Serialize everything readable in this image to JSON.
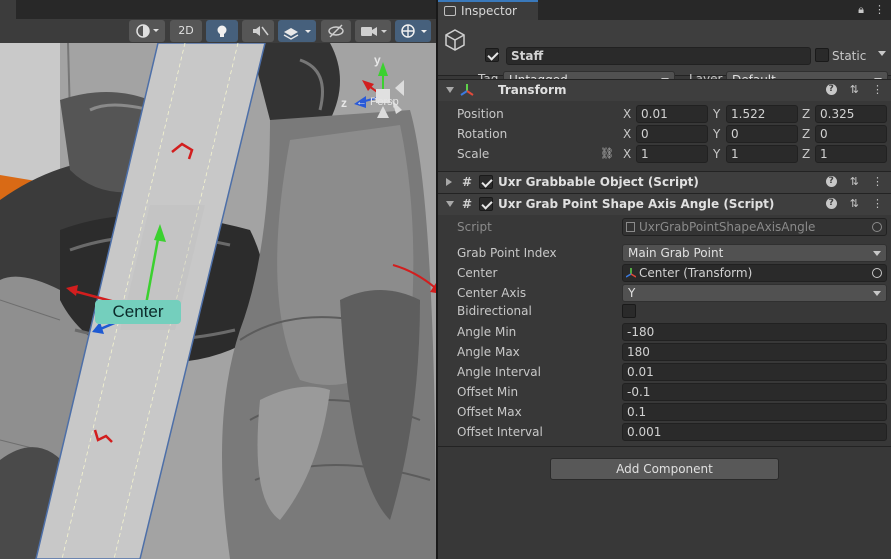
{
  "scene": {
    "toolbar": {
      "mode_2d_label": "2D"
    },
    "handle_label": "Center",
    "gizmo": {
      "y_label": "y",
      "z_label": "z",
      "view_label": "← Persp"
    }
  },
  "inspector": {
    "tab_label": "Inspector",
    "game_object": {
      "name": "Staff",
      "static_label": "Static",
      "tag_label": "Tag",
      "tag_value": "Untagged",
      "layer_label": "Layer",
      "layer_value": "Default"
    },
    "transform": {
      "title": "Transform",
      "position_label": "Position",
      "rotation_label": "Rotation",
      "scale_label": "Scale",
      "position": {
        "x": "0.01",
        "y": "1.522",
        "z": "0.325"
      },
      "rotation": {
        "x": "0",
        "y": "0",
        "z": "0"
      },
      "scale": {
        "x": "1",
        "y": "1",
        "z": "1"
      },
      "x_label": "X",
      "y_label": "Y",
      "z_label": "Z"
    },
    "grabbable": {
      "title": "Uxr Grabbable Object (Script)"
    },
    "shape_axis": {
      "title": "Uxr Grab Point Shape Axis Angle (Script)",
      "script_label": "Script",
      "script_value": "UxrGrabPointShapeAxisAngle",
      "grab_point_index_label": "Grab Point Index",
      "grab_point_index_value": "Main Grab Point",
      "center_label": "Center",
      "center_value": "Center (Transform)",
      "center_axis_label": "Center Axis",
      "center_axis_value": "Y",
      "bidirectional_label": "Bidirectional",
      "angle_min_label": "Angle Min",
      "angle_min_value": "-180",
      "angle_max_label": "Angle Max",
      "angle_max_value": "180",
      "angle_interval_label": "Angle Interval",
      "angle_interval_value": "0.01",
      "offset_min_label": "Offset Min",
      "offset_min_value": "-0.1",
      "offset_max_label": "Offset Max",
      "offset_max_value": "0.1",
      "offset_interval_label": "Offset Interval",
      "offset_interval_value": "0.001"
    },
    "add_component_label": "Add Component"
  },
  "colors": {
    "accent": "#3a79bb",
    "handle_badge": "#74cfbd",
    "panel_bg": "#383838"
  }
}
